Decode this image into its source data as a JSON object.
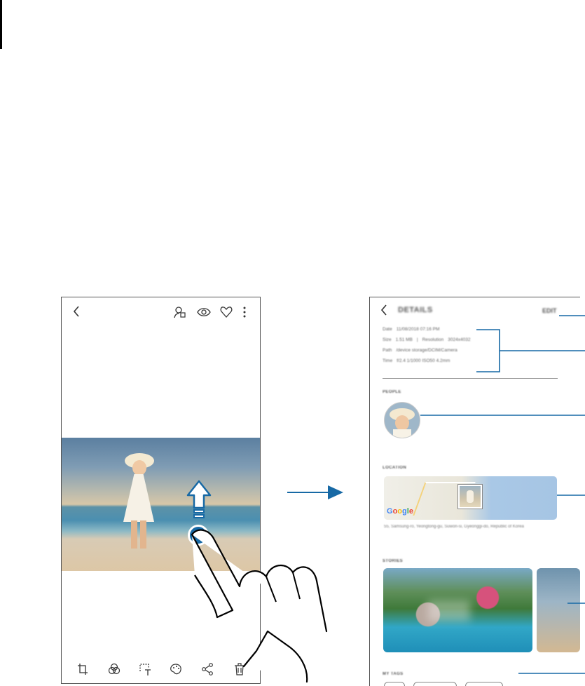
{
  "left_phone": {
    "top_icons": [
      "back-arrow-icon",
      "faces-tag-icon",
      "bixby-vision-icon",
      "heart-icon",
      "more-options-icon"
    ],
    "bottom_icons": [
      "crop-icon",
      "filter-icon",
      "text-sticker-icon",
      "style-palette-icon",
      "share-icon",
      "delete-icon"
    ]
  },
  "right_phone": {
    "title": "DETAILS",
    "edit_label": "EDIT",
    "info": [
      {
        "label": "Date",
        "value": "11/08/2018 07:16 PM"
      },
      {
        "label": "Size",
        "value": "1.51 MB",
        "label2": "Resolution",
        "value2": "3024x4032"
      },
      {
        "label": "Path",
        "value": "/device storage/DCIM/Camera"
      },
      {
        "label": "Time",
        "value": "f/2.4 1/1000 ISO50 4.2mm"
      }
    ],
    "sections": {
      "people": "PEOPLE",
      "location": "LOCATION",
      "stories": "STORIES",
      "tags": "MY TAGS"
    },
    "map_logo": "Google",
    "address": "55, Samsung-ro, Yeongtong-gu, Suwon-si, Gyeonggi-do, Republic of Korea"
  },
  "colors": {
    "accent": "#1769a5",
    "outline": "#555555"
  }
}
